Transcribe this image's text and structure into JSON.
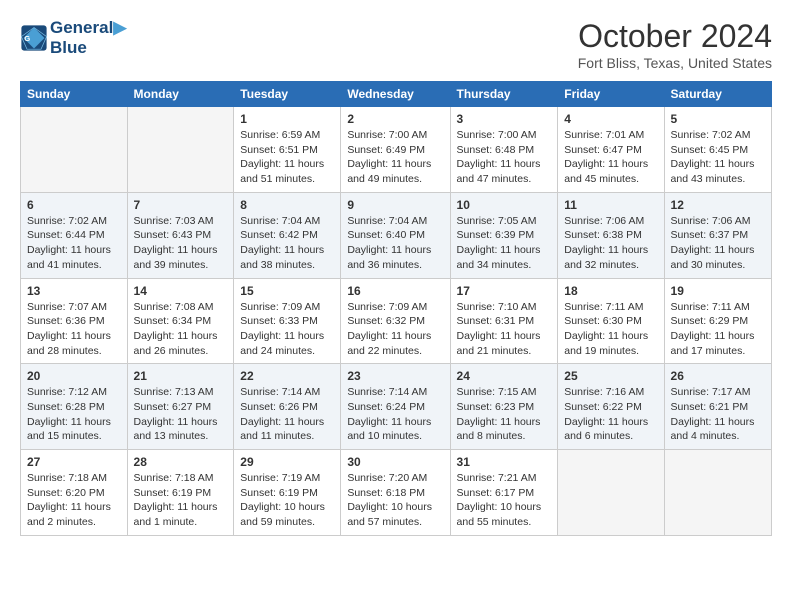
{
  "header": {
    "logo_line1": "General",
    "logo_line2": "Blue",
    "month": "October 2024",
    "location": "Fort Bliss, Texas, United States"
  },
  "weekdays": [
    "Sunday",
    "Monday",
    "Tuesday",
    "Wednesday",
    "Thursday",
    "Friday",
    "Saturday"
  ],
  "weeks": [
    [
      {
        "day": "",
        "info": ""
      },
      {
        "day": "",
        "info": ""
      },
      {
        "day": "1",
        "info": "Sunrise: 6:59 AM\nSunset: 6:51 PM\nDaylight: 11 hours and 51 minutes."
      },
      {
        "day": "2",
        "info": "Sunrise: 7:00 AM\nSunset: 6:49 PM\nDaylight: 11 hours and 49 minutes."
      },
      {
        "day": "3",
        "info": "Sunrise: 7:00 AM\nSunset: 6:48 PM\nDaylight: 11 hours and 47 minutes."
      },
      {
        "day": "4",
        "info": "Sunrise: 7:01 AM\nSunset: 6:47 PM\nDaylight: 11 hours and 45 minutes."
      },
      {
        "day": "5",
        "info": "Sunrise: 7:02 AM\nSunset: 6:45 PM\nDaylight: 11 hours and 43 minutes."
      }
    ],
    [
      {
        "day": "6",
        "info": "Sunrise: 7:02 AM\nSunset: 6:44 PM\nDaylight: 11 hours and 41 minutes."
      },
      {
        "day": "7",
        "info": "Sunrise: 7:03 AM\nSunset: 6:43 PM\nDaylight: 11 hours and 39 minutes."
      },
      {
        "day": "8",
        "info": "Sunrise: 7:04 AM\nSunset: 6:42 PM\nDaylight: 11 hours and 38 minutes."
      },
      {
        "day": "9",
        "info": "Sunrise: 7:04 AM\nSunset: 6:40 PM\nDaylight: 11 hours and 36 minutes."
      },
      {
        "day": "10",
        "info": "Sunrise: 7:05 AM\nSunset: 6:39 PM\nDaylight: 11 hours and 34 minutes."
      },
      {
        "day": "11",
        "info": "Sunrise: 7:06 AM\nSunset: 6:38 PM\nDaylight: 11 hours and 32 minutes."
      },
      {
        "day": "12",
        "info": "Sunrise: 7:06 AM\nSunset: 6:37 PM\nDaylight: 11 hours and 30 minutes."
      }
    ],
    [
      {
        "day": "13",
        "info": "Sunrise: 7:07 AM\nSunset: 6:36 PM\nDaylight: 11 hours and 28 minutes."
      },
      {
        "day": "14",
        "info": "Sunrise: 7:08 AM\nSunset: 6:34 PM\nDaylight: 11 hours and 26 minutes."
      },
      {
        "day": "15",
        "info": "Sunrise: 7:09 AM\nSunset: 6:33 PM\nDaylight: 11 hours and 24 minutes."
      },
      {
        "day": "16",
        "info": "Sunrise: 7:09 AM\nSunset: 6:32 PM\nDaylight: 11 hours and 22 minutes."
      },
      {
        "day": "17",
        "info": "Sunrise: 7:10 AM\nSunset: 6:31 PM\nDaylight: 11 hours and 21 minutes."
      },
      {
        "day": "18",
        "info": "Sunrise: 7:11 AM\nSunset: 6:30 PM\nDaylight: 11 hours and 19 minutes."
      },
      {
        "day": "19",
        "info": "Sunrise: 7:11 AM\nSunset: 6:29 PM\nDaylight: 11 hours and 17 minutes."
      }
    ],
    [
      {
        "day": "20",
        "info": "Sunrise: 7:12 AM\nSunset: 6:28 PM\nDaylight: 11 hours and 15 minutes."
      },
      {
        "day": "21",
        "info": "Sunrise: 7:13 AM\nSunset: 6:27 PM\nDaylight: 11 hours and 13 minutes."
      },
      {
        "day": "22",
        "info": "Sunrise: 7:14 AM\nSunset: 6:26 PM\nDaylight: 11 hours and 11 minutes."
      },
      {
        "day": "23",
        "info": "Sunrise: 7:14 AM\nSunset: 6:24 PM\nDaylight: 11 hours and 10 minutes."
      },
      {
        "day": "24",
        "info": "Sunrise: 7:15 AM\nSunset: 6:23 PM\nDaylight: 11 hours and 8 minutes."
      },
      {
        "day": "25",
        "info": "Sunrise: 7:16 AM\nSunset: 6:22 PM\nDaylight: 11 hours and 6 minutes."
      },
      {
        "day": "26",
        "info": "Sunrise: 7:17 AM\nSunset: 6:21 PM\nDaylight: 11 hours and 4 minutes."
      }
    ],
    [
      {
        "day": "27",
        "info": "Sunrise: 7:18 AM\nSunset: 6:20 PM\nDaylight: 11 hours and 2 minutes."
      },
      {
        "day": "28",
        "info": "Sunrise: 7:18 AM\nSunset: 6:19 PM\nDaylight: 11 hours and 1 minute."
      },
      {
        "day": "29",
        "info": "Sunrise: 7:19 AM\nSunset: 6:19 PM\nDaylight: 10 hours and 59 minutes."
      },
      {
        "day": "30",
        "info": "Sunrise: 7:20 AM\nSunset: 6:18 PM\nDaylight: 10 hours and 57 minutes."
      },
      {
        "day": "31",
        "info": "Sunrise: 7:21 AM\nSunset: 6:17 PM\nDaylight: 10 hours and 55 minutes."
      },
      {
        "day": "",
        "info": ""
      },
      {
        "day": "",
        "info": ""
      }
    ]
  ]
}
